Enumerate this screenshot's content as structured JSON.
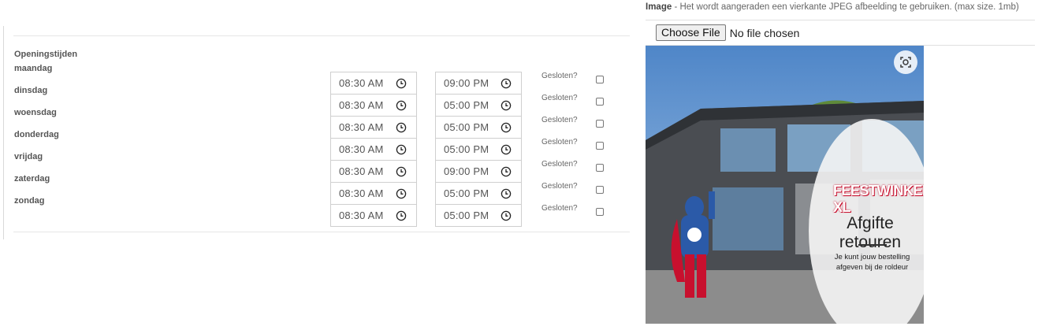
{
  "opening_hours": {
    "section_title": "Openingstijden",
    "closed_label": "Gesloten?",
    "days": [
      {
        "name": "maandag",
        "open": "08:30 AM",
        "close": "09:00 PM"
      },
      {
        "name": "dinsdag",
        "open": "08:30 AM",
        "close": "05:00 PM"
      },
      {
        "name": "woensdag",
        "open": "08:30 AM",
        "close": "05:00 PM"
      },
      {
        "name": "donderdag",
        "open": "08:30 AM",
        "close": "05:00 PM"
      },
      {
        "name": "vrijdag",
        "open": "08:30 AM",
        "close": "09:00 PM"
      },
      {
        "name": "zaterdag",
        "open": "08:30 AM",
        "close": "05:00 PM"
      },
      {
        "name": "zondag",
        "open": "08:30 AM",
        "close": "05:00 PM"
      }
    ]
  },
  "image_upload": {
    "label_bold": "Image",
    "label_rest": " - Het wordt aangeraden een vierkante JPEG afbeelding te gebruiken. (max size. 1mb)",
    "choose_button": "Choose File",
    "file_status": "No file chosen",
    "preview": {
      "brand": "FEESTWINKEL XL",
      "headline": "Afgifte retouren",
      "subtext_line1": "Je kunt jouw bestelling",
      "subtext_line2": "afgeven bij de roldeur"
    }
  },
  "icons": {
    "time_icon": "clock-icon",
    "preview_overlay_icon": "scan-icon"
  }
}
